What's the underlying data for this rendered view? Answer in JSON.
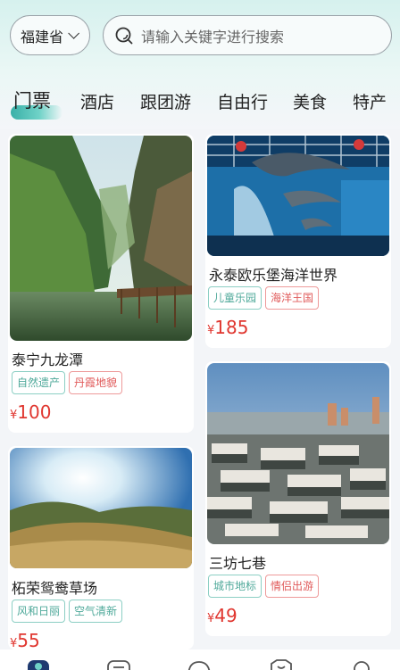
{
  "header": {
    "region": "福建省",
    "search_placeholder": "请输入关键字进行搜索"
  },
  "tabs": [
    {
      "label": "门票",
      "active": true
    },
    {
      "label": "酒店",
      "active": false
    },
    {
      "label": "跟团游",
      "active": false
    },
    {
      "label": "自由行",
      "active": false
    },
    {
      "label": "美食",
      "active": false
    },
    {
      "label": "特产",
      "active": false
    }
  ],
  "cards": [
    {
      "name": "泰宁九龙潭",
      "tags": [
        "自然遗产",
        "丹霞地貌"
      ],
      "currency": "¥",
      "price": "100"
    },
    {
      "name": "永泰欧乐堡海洋世界",
      "tags": [
        "儿童乐园",
        "海洋王国"
      ],
      "currency": "¥",
      "price": "185"
    },
    {
      "name": "柘荣鸳鸯草场",
      "tags": [
        "风和日丽",
        "空气清新"
      ],
      "currency": "¥",
      "price": "55"
    },
    {
      "name": "三坊七巷",
      "tags": [
        "城市地标",
        "情侣出游"
      ],
      "currency": "¥",
      "price": "49"
    }
  ],
  "colors": {
    "accent": "#3ab0a8",
    "price": "#e0362f",
    "tag_green": "#4fa99a",
    "tag_red": "#e05a5a"
  },
  "bottom_nav": [
    "home-icon",
    "list-icon",
    "chat-icon",
    "shop-icon",
    "profile-icon"
  ]
}
